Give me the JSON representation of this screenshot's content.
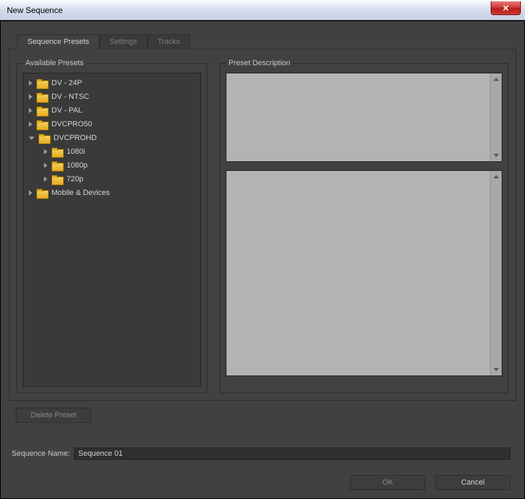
{
  "window": {
    "title": "New Sequence"
  },
  "tabs": [
    {
      "label": "Sequence Presets",
      "active": true
    },
    {
      "label": "Settings",
      "active": false
    },
    {
      "label": "Tracks",
      "active": false
    }
  ],
  "presets": {
    "heading": "Available Presets",
    "tree": [
      {
        "label": "DV - 24P",
        "expanded": false,
        "depth": 0
      },
      {
        "label": "DV - NTSC",
        "expanded": false,
        "depth": 0
      },
      {
        "label": "DV - PAL",
        "expanded": false,
        "depth": 0
      },
      {
        "label": "DVCPRO50",
        "expanded": false,
        "depth": 0
      },
      {
        "label": "DVCPROHD",
        "expanded": true,
        "depth": 0
      },
      {
        "label": "1080i",
        "expanded": false,
        "depth": 1
      },
      {
        "label": "1080p",
        "expanded": false,
        "depth": 1
      },
      {
        "label": "720p",
        "expanded": false,
        "depth": 1
      },
      {
        "label": "Mobile & Devices",
        "expanded": false,
        "depth": 0
      }
    ]
  },
  "description": {
    "heading": "Preset Description"
  },
  "buttons": {
    "delete_preset": "Delete Preset",
    "ok": "OK",
    "cancel": "Cancel"
  },
  "sequence_name_label": "Sequence Name:",
  "sequence_name_value": "Sequence 01"
}
